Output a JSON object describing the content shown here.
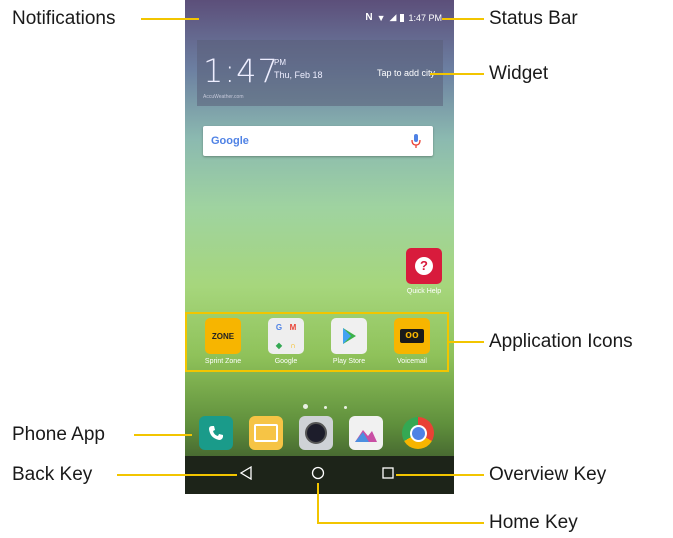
{
  "status_bar": {
    "time": "1:47 PM"
  },
  "widget": {
    "time": "1:47",
    "ampm": "PM",
    "date": "Thu, Feb 18",
    "city_prompt": "Tap to add city",
    "credit": "AccuWeather.com"
  },
  "search": {
    "logo": "Google"
  },
  "apps": [
    {
      "label": "Sprint Zone",
      "icon": "sprint-zone-icon",
      "color": "#f7b500"
    },
    {
      "label": "Google",
      "icon": "google-folder-icon",
      "color": "#f0f0f0"
    },
    {
      "label": "Play Store",
      "icon": "play-store-icon",
      "color": "#f0f0f0"
    },
    {
      "label": "Voicemail",
      "icon": "voicemail-icon",
      "color": "#f7b500"
    }
  ],
  "quick_help": {
    "label": "Quick Help",
    "icon": "quick-help-icon",
    "color": "#d81b3c"
  },
  "dock": [
    {
      "name": "phone",
      "icon": "phone-icon",
      "color": "#1a9b8a"
    },
    {
      "name": "messages",
      "icon": "messages-icon",
      "color": "#f6c445"
    },
    {
      "name": "camera",
      "icon": "camera-icon",
      "color": "#cfd2d6"
    },
    {
      "name": "gallery",
      "icon": "gallery-icon",
      "color": "#f1f1f1"
    },
    {
      "name": "chrome",
      "icon": "chrome-icon",
      "color": "#e94235"
    }
  ],
  "callouts": {
    "notifications": "Notifications",
    "status_bar": "Status Bar",
    "widget": "Widget",
    "application_icons": "Application Icons",
    "phone_app": "Phone App",
    "back_key": "Back Key",
    "overview_key": "Overview Key",
    "home_key": "Home Key"
  },
  "colors": {
    "accent": "#f2c500"
  }
}
